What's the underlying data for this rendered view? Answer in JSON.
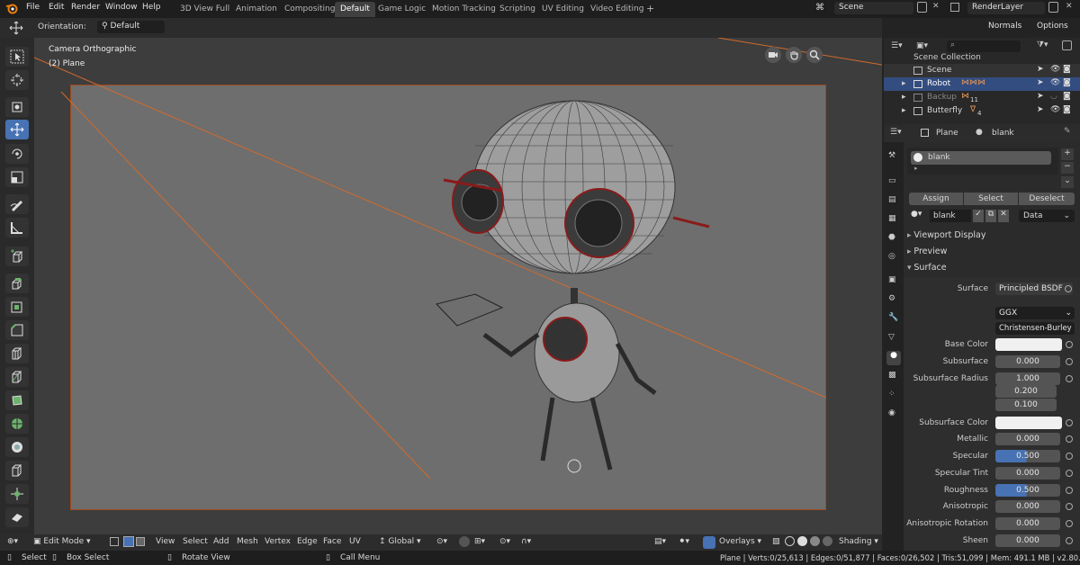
{
  "menu": {
    "items": [
      "File",
      "Edit",
      "Render",
      "Window",
      "Help"
    ]
  },
  "workspaces": {
    "tabs": [
      "3D View Full",
      "Animation",
      "Compositing",
      "Default",
      "Game Logic",
      "Motion Tracking",
      "Scripting",
      "UV Editing",
      "Video Editing",
      "+"
    ],
    "active": "Default"
  },
  "scene": {
    "name": "Scene",
    "layer": "RenderLayer"
  },
  "viewport_header": {
    "orientation_label": "Orientation:",
    "orientation_value": "Default",
    "normals": "Normals",
    "options": "Options"
  },
  "viewport": {
    "camera": "Camera Orthographic",
    "object": "(2) Plane"
  },
  "outliner": {
    "collection": "Scene Collection",
    "rows": [
      {
        "name": "Scene"
      },
      {
        "name": "Robot"
      },
      {
        "name": "Backup"
      },
      {
        "name": "Butterfly"
      }
    ],
    "backup_badge": "11",
    "butterfly_badge": "4"
  },
  "properties": {
    "object": "Plane",
    "material_name": "blank",
    "slot_name": "blank",
    "assign": "Assign",
    "select": "Select",
    "deselect": "Deselect",
    "mat_field": "blank",
    "data_label": "Data",
    "panels": [
      "Viewport Display",
      "Preview",
      "Surface"
    ],
    "surface_label": "Surface",
    "surface_value": "Principled BSDF",
    "distribution": "GGX",
    "subsurface_method": "Christensen-Burley",
    "fields": [
      {
        "label": "Base Color",
        "value": "",
        "kind": "white"
      },
      {
        "label": "Subsurface",
        "value": "0.000",
        "kind": "num"
      },
      {
        "label": "Subsurface Radius",
        "value": "1.000",
        "kind": "num"
      },
      {
        "label": "",
        "value": "0.200",
        "kind": "num"
      },
      {
        "label": "",
        "value": "0.100",
        "kind": "num"
      },
      {
        "label": "Subsurface Color",
        "value": "",
        "kind": "white"
      },
      {
        "label": "Metallic",
        "value": "0.000",
        "kind": "num"
      },
      {
        "label": "Specular",
        "value": "0.500",
        "kind": "blue"
      },
      {
        "label": "Specular Tint",
        "value": "0.000",
        "kind": "num"
      },
      {
        "label": "Roughness",
        "value": "0.500",
        "kind": "blue"
      },
      {
        "label": "Anisotropic",
        "value": "0.000",
        "kind": "num"
      },
      {
        "label": "Anisotropic Rotation",
        "value": "0.000",
        "kind": "num"
      },
      {
        "label": "Sheen",
        "value": "0.000",
        "kind": "num"
      }
    ]
  },
  "bottom_header": {
    "mode": "Edit Mode",
    "menus": [
      "View",
      "Select",
      "Add",
      "Mesh",
      "Vertex",
      "Edge",
      "Face",
      "UV"
    ],
    "transform": "Global",
    "overlays": "Overlays",
    "shading": "Shading"
  },
  "statusbar": {
    "select": "Select",
    "box_select": "Box Select",
    "rotate": "Rotate View",
    "call_menu": "Call Menu",
    "stats": "Plane | Verts:0/25,613 | Edges:0/51,877 | Faces:0/26,502 | Tris:51,099 | Mem: 491.1 MB | v2.80.55"
  },
  "colors": {
    "accent": "#4772b3",
    "camera_frame": "#a04a1c"
  }
}
